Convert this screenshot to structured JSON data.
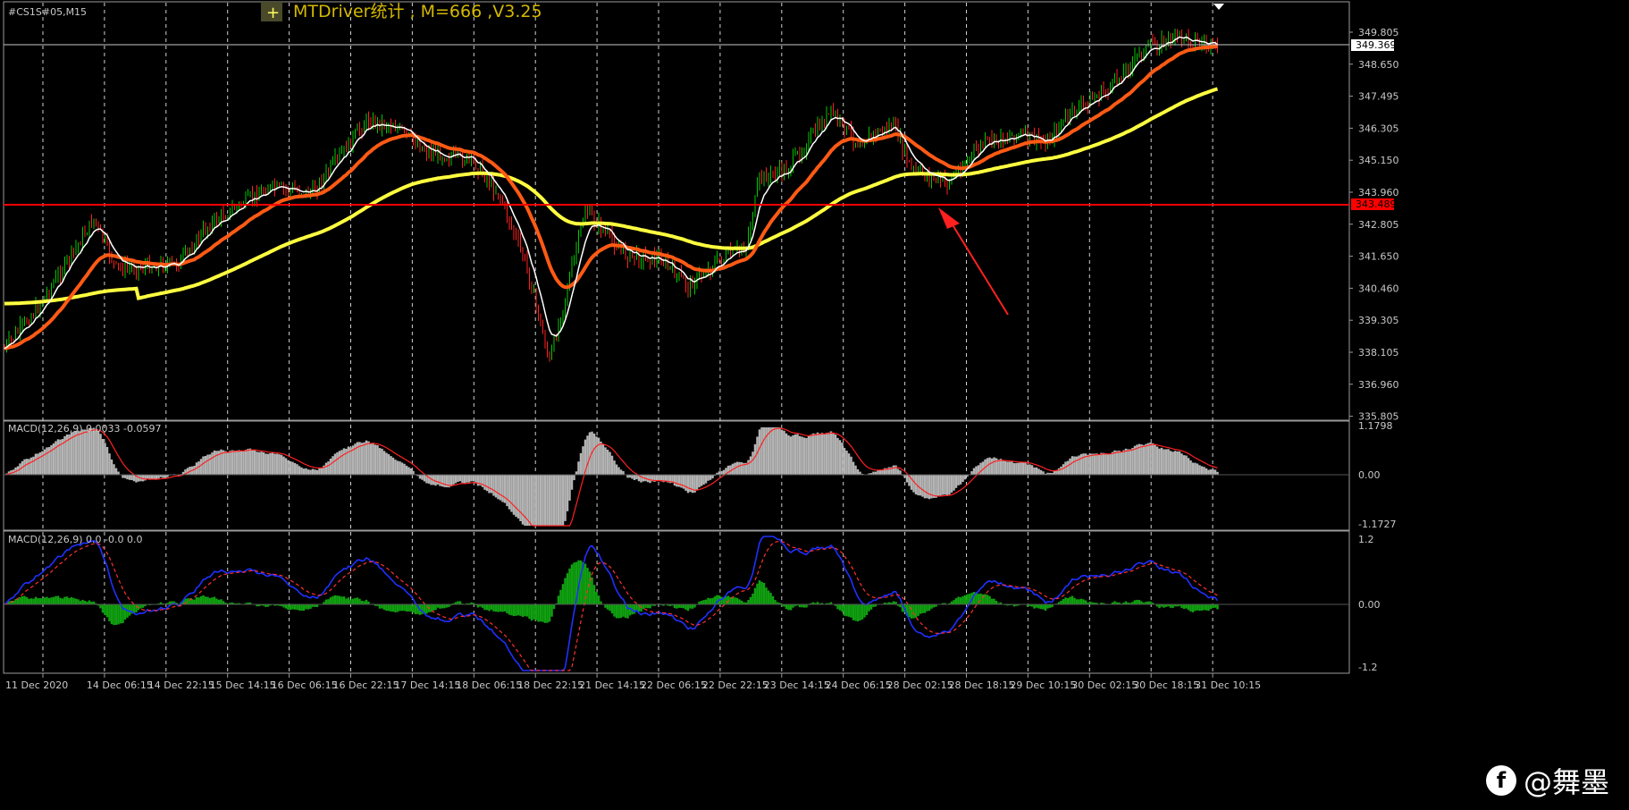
{
  "window": {
    "symbol_label": "#CS1S#05,M15",
    "indicator_title": "MTDriver统计 , M=666 ,V3.25",
    "plus_icon": "+"
  },
  "price_panel": {
    "price_ticks": [
      "349.805",
      "348.650",
      "347.495",
      "346.305",
      "345.150",
      "343.960",
      "342.805",
      "341.650",
      "340.460",
      "339.305",
      "338.105",
      "336.960",
      "335.805"
    ],
    "current_price": "349.369",
    "horizontal_line_price": "343.489",
    "colors": {
      "candle_up": "#00c800",
      "candle_down": "#ff2020",
      "ma_fast": "#ffffff",
      "ma_mid": "#ff5a14",
      "ma_slow": "#ffff40",
      "hline": "#ff0000",
      "arrow": "#ff2020"
    }
  },
  "macd1": {
    "label": "MACD(12,26,9) 0.0033 -0.0597",
    "ticks": [
      "1.1798",
      "0.00",
      "-1.1727"
    ]
  },
  "macd2": {
    "label": "MACD(12,26,9) 0.0 -0.0 0.0",
    "ticks": [
      "1.2",
      "0.00",
      "-1.2"
    ]
  },
  "time_axis": [
    "11 Dec 2020",
    "14 Dec 06:15",
    "14 Dec 22:15",
    "15 Dec 14:15",
    "16 Dec 06:15",
    "16 Dec 22:15",
    "17 Dec 14:15",
    "18 Dec 06:15",
    "18 Dec 22:15",
    "21 Dec 14:15",
    "22 Dec 06:15",
    "22 Dec 22:15",
    "23 Dec 14:15",
    "24 Dec 06:15",
    "28 Dec 02:15",
    "28 Dec 18:15",
    "29 Dec 10:15",
    "30 Dec 02:15",
    "30 Dec 18:15",
    "31 Dec 10:15"
  ],
  "watermark": {
    "logo": "f",
    "name": "@舞墨"
  }
}
